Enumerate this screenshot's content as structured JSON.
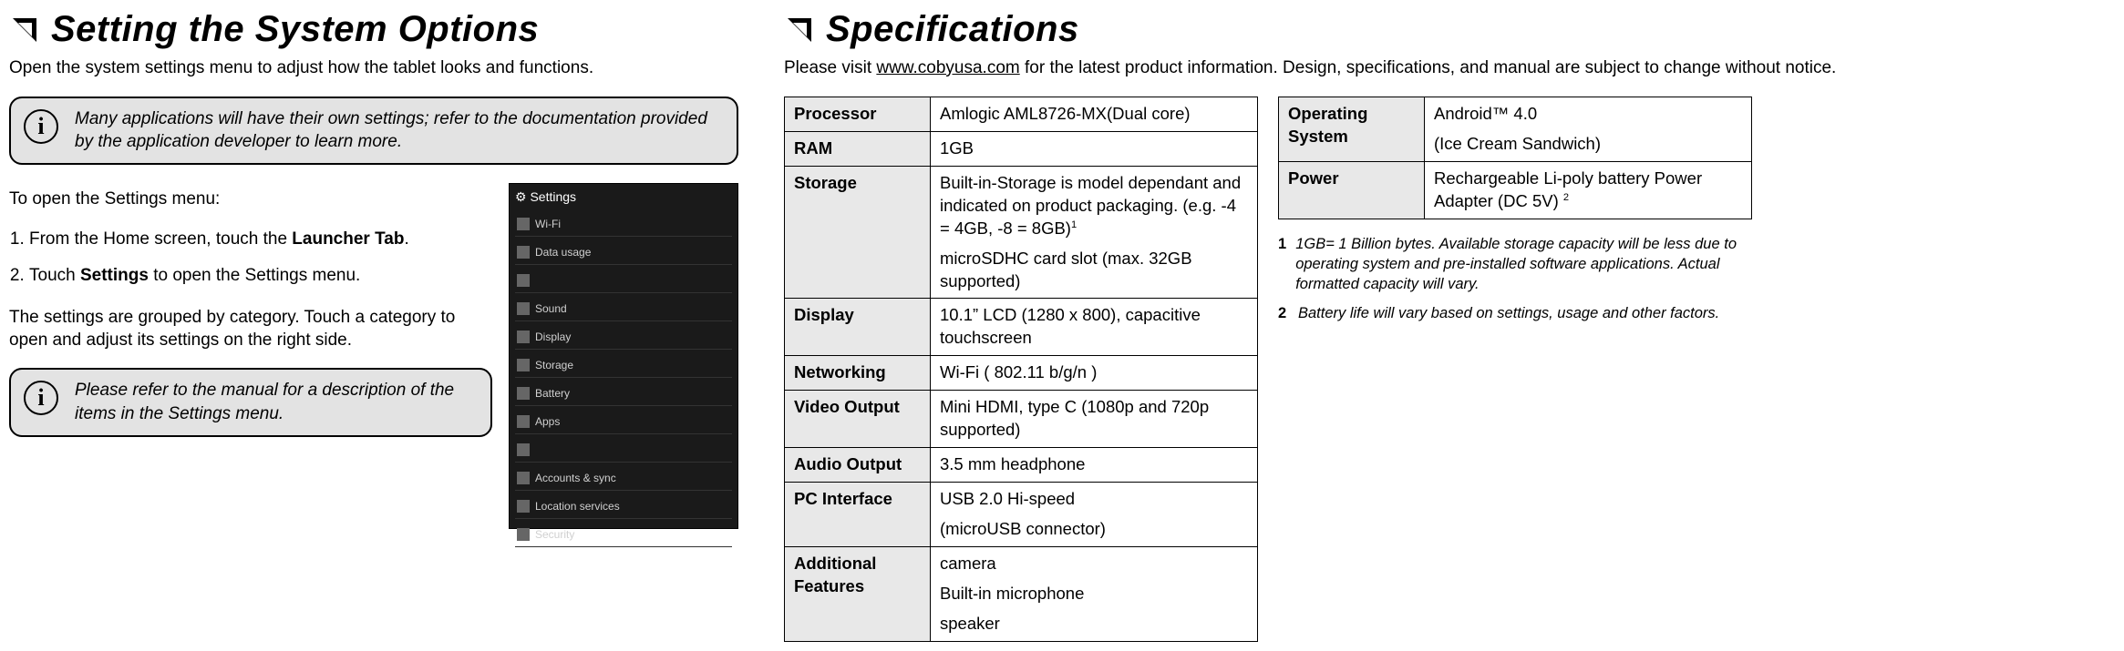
{
  "left": {
    "heading": "Setting the System Options",
    "intro": "Open the system settings menu to adjust how the tablet looks and functions.",
    "callout1": "Many applications will have their own settings; refer to the documentation provided by the application developer to learn more.",
    "open_settings_heading": "To open the Settings menu:",
    "step1_pre": "From the Home screen, touch the ",
    "step1_bold": "Launcher Tab",
    "step1_post": ".",
    "step2_pre": "Touch ",
    "step2_bold": "Settings",
    "step2_post": " to open the Settings menu.",
    "group_text": "The settings are grouped by category. Touch a category to open and adjust its settings on the right side.",
    "callout2": "Please refer to the manual for a description of the items in the Settings menu.",
    "settings_rows": [
      "Wi-Fi",
      "Data usage",
      "",
      "Sound",
      "Display",
      "Storage",
      "Battery",
      "Apps",
      "",
      "Accounts & sync",
      "Location services",
      "Security"
    ]
  },
  "right": {
    "heading": "Speciﬁcations",
    "intro_pre": "Please visit ",
    "intro_link": "www.cobyusa.com",
    "intro_post": " for the latest product information. Design, speciﬁcations, and manual are subject to change without notice.",
    "specs1": {
      "processor_l": "Processor",
      "processor_v": "Amlogic AML8726-MX(Dual core)",
      "ram_l": "RAM",
      "ram_v": "1GB",
      "storage_l": "Storage",
      "storage_v1": "Built-in-Storage is model dependant and indicated on product packaging. (e.g. -4 = 4GB, -8 = 8GB)",
      "storage_sup": "1",
      "storage_v2": "microSDHC card slot (max. 32GB supported)",
      "display_l": "Display",
      "display_v": "10.1”  LCD (1280 x 800), capacitive touchscreen",
      "networking_l": "Networking",
      "networking_v": "Wi-Fi ( 802.11 b/g/n )",
      "video_l": "Video Output",
      "video_v": "Mini HDMI, type C (1080p and 720p supported)",
      "audio_l": "Audio Output",
      "audio_v": "3.5 mm headphone",
      "pc_l": "PC Interface",
      "pc_v1": "USB 2.0 Hi-speed",
      "pc_v2": "(microUSB connector)",
      "addl_l": "Additional Features",
      "addl_v1": " camera",
      "addl_v2": "Built-in microphone",
      "addl_v3": "speaker"
    },
    "specs2": {
      "os_l": "Operating System",
      "os_v1": "Android™ 4.0",
      "os_v2": "(Ice Cream Sandwich)",
      "power_l": "Power",
      "power_v": "Rechargeable Li-poly battery Power Adapter (DC 5V) ",
      "power_sup": "2"
    },
    "fn1_n": "1",
    "fn1": "1GB= 1 Billion bytes.  Available storage capacity will be less due to operating system and pre-installed software applications.   Actual formatted capacity will vary.",
    "fn2_n": "2",
    "fn2": "Battery life will vary based on settings, usage and other factors."
  }
}
